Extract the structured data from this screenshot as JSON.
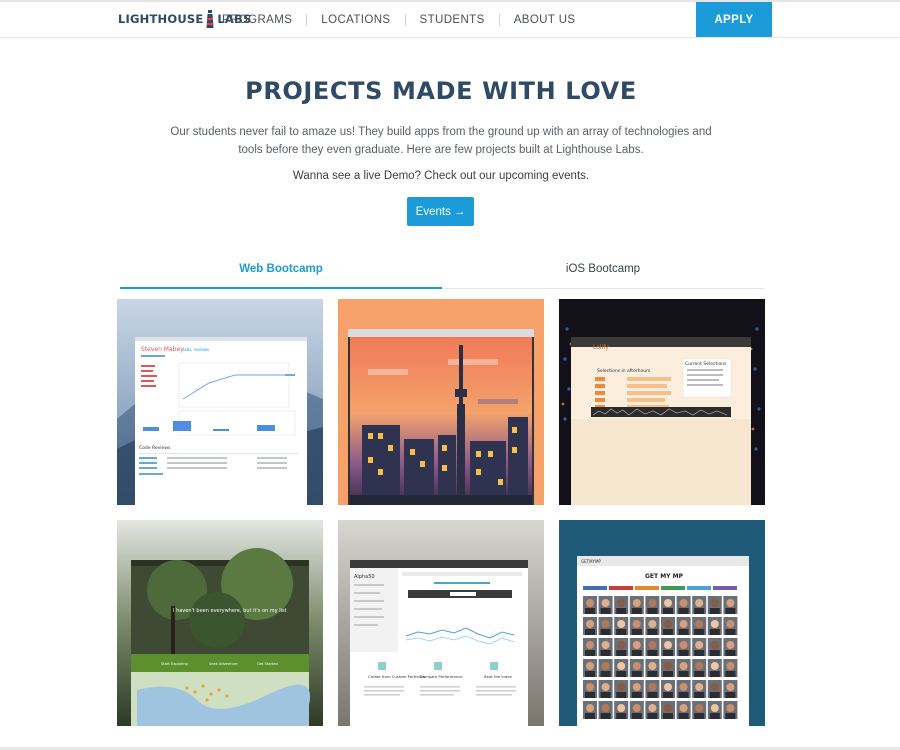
{
  "header": {
    "logo_left": "LIGHTHOUSE",
    "logo_right": "LABS",
    "nav": [
      {
        "label": "PROGRAMS"
      },
      {
        "label": "LOCATIONS"
      },
      {
        "label": "STUDENTS"
      },
      {
        "label": "ABOUT US"
      }
    ],
    "apply_label": "APPLY"
  },
  "hero": {
    "title": "PROJECTS MADE WITH LOVE",
    "intro": "Our students never fail to amaze us! They build apps from the ground up with an array of technologies and tools before they even graduate. Here are few projects built at Lighthouse Labs.",
    "demo": "Wanna see a live Demo? Check out our upcoming events.",
    "events_label": "Events",
    "events_arrow": "→"
  },
  "tabs": [
    {
      "label": "Web Bootcamp",
      "active": true
    },
    {
      "label": "iOS Bootcamp",
      "active": false
    }
  ],
  "projects": [
    {
      "name": "Steven Mabey",
      "tag": "labs, reviews",
      "section": "Code Reviews"
    },
    {
      "name": ""
    },
    {
      "name": "Lolify",
      "subtitle": "Selections in afterhours",
      "panel": "Current Selections"
    },
    {
      "caption": "I haven't been everywhere, but it's on my list",
      "actions": [
        "Start Exploring",
        "Seek Adventure",
        "Get Started"
      ]
    },
    {
      "name": "Alpha50",
      "features": [
        "Create from Custom Portfolios",
        "Compare Performance",
        "Beat the Index"
      ]
    },
    {
      "brand": "GETMYMP",
      "heading": "GET MY MP"
    }
  ],
  "colors": {
    "accent": "#1c9bd9",
    "brand_dark": "#2f4a66"
  }
}
